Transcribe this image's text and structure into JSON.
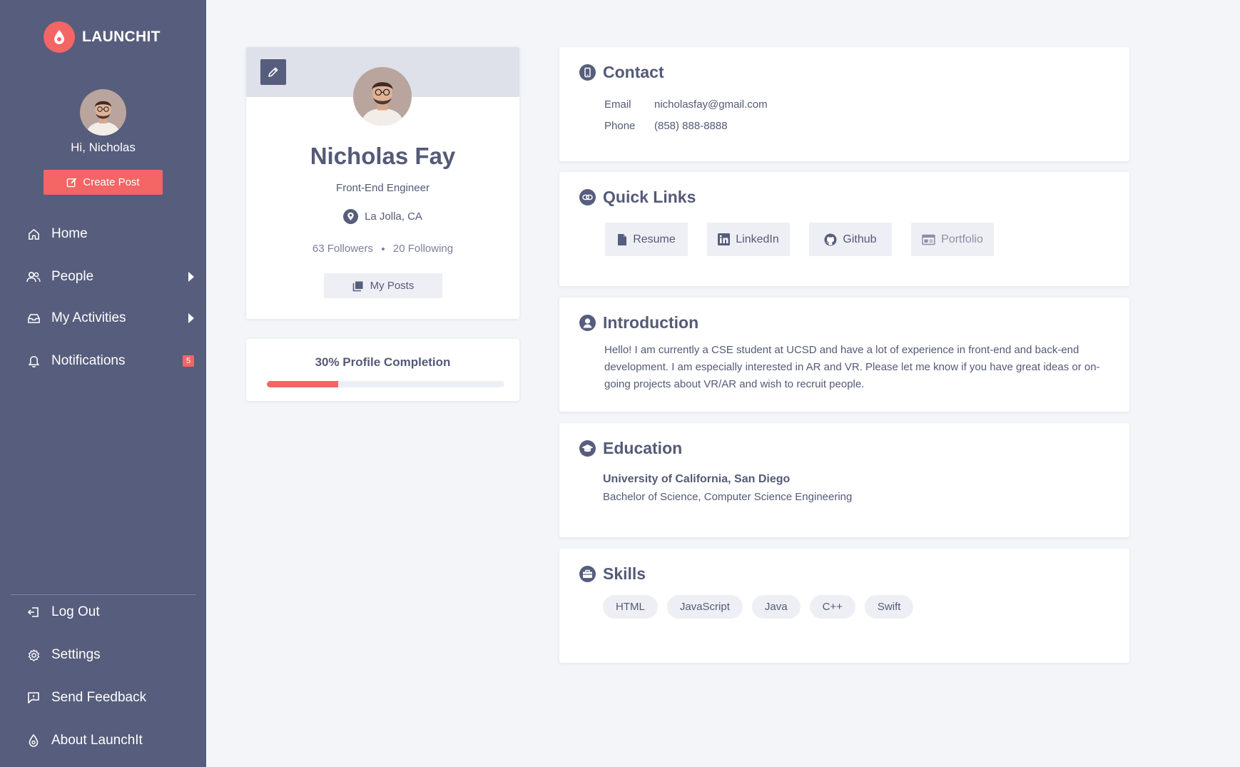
{
  "app": {
    "name": "LAUNCHIT"
  },
  "sidebar": {
    "greeting": "Hi, Nicholas",
    "create_post": "Create Post",
    "nav": [
      {
        "label": "Home",
        "icon": "home-icon"
      },
      {
        "label": "People",
        "icon": "people-icon",
        "has_submenu": true
      },
      {
        "label": "My Activities",
        "icon": "inbox-icon",
        "has_submenu": true
      },
      {
        "label": "Notifications",
        "icon": "bell-icon",
        "badge": "5"
      }
    ],
    "footer_nav": [
      {
        "label": "Log Out",
        "icon": "logout-icon"
      },
      {
        "label": "Settings",
        "icon": "gear-icon"
      },
      {
        "label": "Send Feedback",
        "icon": "feedback-icon"
      },
      {
        "label": "About LaunchIt",
        "icon": "launchit-drop-icon"
      }
    ]
  },
  "profile": {
    "name": "Nicholas Fay",
    "title": "Front-End Engineer",
    "location": "La Jolla, CA",
    "followers": "63 Followers",
    "following": "20 Following",
    "my_posts": "My Posts"
  },
  "completion": {
    "label": "30% Profile Completion",
    "percent": 30
  },
  "contact": {
    "title": "Contact",
    "email_label": "Email",
    "email": "nicholasfay@gmail.com",
    "phone_label": "Phone",
    "phone": "(858) 888-8888"
  },
  "quick_links": {
    "title": "Quick Links",
    "items": [
      {
        "label": "Resume",
        "icon": "file-icon"
      },
      {
        "label": "LinkedIn",
        "icon": "linkedin-icon"
      },
      {
        "label": "Github",
        "icon": "github-icon"
      },
      {
        "label": "Portfolio",
        "icon": "browser-window-icon",
        "disabled": true
      }
    ]
  },
  "introduction": {
    "title": "Introduction",
    "text": "Hello! I am currently a CSE student at UCSD and have a lot of experience in front-end and back-end development. I am especially interested in AR and VR. Please let me know if you have great ideas or on-going projects about VR/AR and wish to recruit people."
  },
  "education": {
    "title": "Education",
    "school": "University of California, San Diego",
    "degree": "Bachelor of Science, Computer Science Engineering"
  },
  "skills": {
    "title": "Skills",
    "items": [
      "HTML",
      "JavaScript",
      "Java",
      "C++",
      "Swift"
    ]
  },
  "colors": {
    "sidebar": "#575d7c",
    "accent": "#f46565",
    "text": "#545a77",
    "background": "#f4f5f9",
    "chip": "#eeeff4"
  }
}
